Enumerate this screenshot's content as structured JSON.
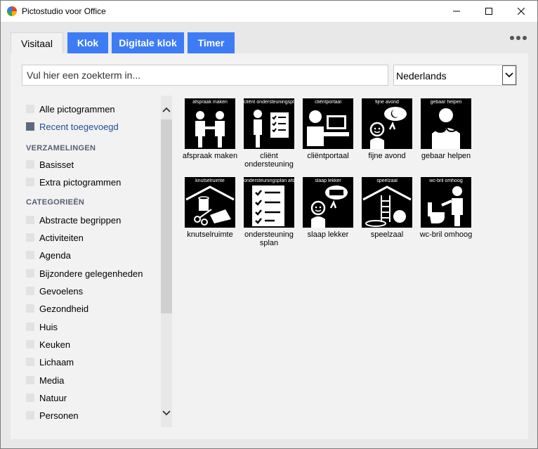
{
  "window": {
    "title": "Pictostudio voor Office"
  },
  "tabs": [
    {
      "label": "Visitaal",
      "active": true
    },
    {
      "label": "Klok",
      "active": false
    },
    {
      "label": "Digitale klok",
      "active": false
    },
    {
      "label": "Timer",
      "active": false
    }
  ],
  "search": {
    "placeholder": "Vul hier een zoekterm in..."
  },
  "language": {
    "selected": "Nederlands"
  },
  "sidebar": {
    "top_items": [
      {
        "label": "Alle pictogrammen",
        "checked": false
      },
      {
        "label": "Recent toegevoegd",
        "checked": true
      }
    ],
    "collections_header": "VERZAMELINGEN",
    "collections": [
      {
        "label": "Basisset"
      },
      {
        "label": "Extra pictogrammen"
      }
    ],
    "categories_header": "CATEGORIEËN",
    "categories": [
      {
        "label": "Abstracte begrippen"
      },
      {
        "label": "Activiteiten"
      },
      {
        "label": "Agenda"
      },
      {
        "label": "Bijzondere gelegenheden"
      },
      {
        "label": "Gevoelens"
      },
      {
        "label": "Gezondheid"
      },
      {
        "label": "Huis"
      },
      {
        "label": "Keuken"
      },
      {
        "label": "Lichaam"
      },
      {
        "label": "Media"
      },
      {
        "label": "Natuur"
      },
      {
        "label": "Personen"
      }
    ]
  },
  "pictos": [
    {
      "caption": "afspraak maken",
      "label": "afspraak maken",
      "icon": "two-people-handshake"
    },
    {
      "caption": "cliënt ondersteuningsplan",
      "label": "cliënt ondersteuning",
      "icon": "person-checklist"
    },
    {
      "caption": "cliëntportaal",
      "label": "cliëntportaal",
      "icon": "person-computer"
    },
    {
      "caption": "fijne avond",
      "label": "fijne avond",
      "icon": "person-moon"
    },
    {
      "caption": "gebaar helpen",
      "label": "gebaar helpen",
      "icon": "sign-language-help"
    },
    {
      "caption": "knutselruimte",
      "label": "knutselruimte",
      "icon": "craft-room"
    },
    {
      "caption": "ondersteuningsplan afspraken",
      "label": "ondersteuning splan",
      "icon": "checklist-document"
    },
    {
      "caption": "slaap lekker",
      "label": "slaap lekker",
      "icon": "person-bed"
    },
    {
      "caption": "speelzaal",
      "label": "speelzaal",
      "icon": "playroom"
    },
    {
      "caption": "wc-bril omhoog",
      "label": "wc-bril omhoog",
      "icon": "toilet-seat-up"
    }
  ]
}
